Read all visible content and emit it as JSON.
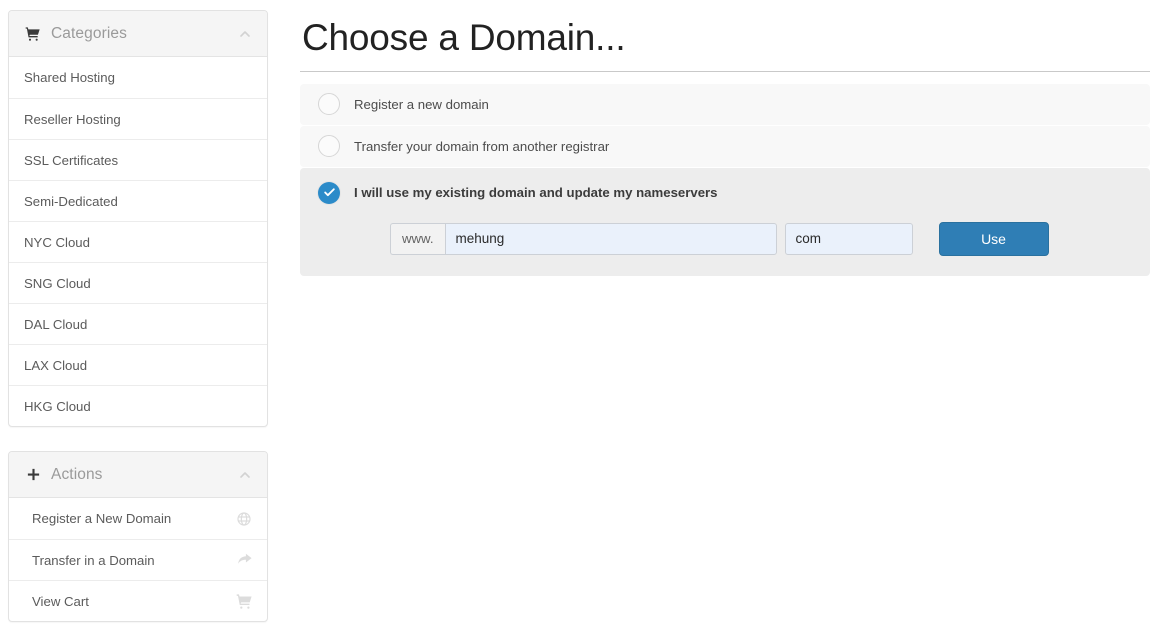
{
  "sidebar": {
    "categories_panel": {
      "icon": "cart-icon",
      "title": "Categories",
      "collapse_icon": "chevron-up-icon",
      "items": [
        {
          "label": "Shared Hosting"
        },
        {
          "label": "Reseller Hosting"
        },
        {
          "label": "SSL Certificates"
        },
        {
          "label": "Semi-Dedicated"
        },
        {
          "label": "NYC Cloud"
        },
        {
          "label": "SNG Cloud"
        },
        {
          "label": "DAL Cloud"
        },
        {
          "label": "LAX Cloud"
        },
        {
          "label": "HKG Cloud"
        }
      ]
    },
    "actions_panel": {
      "icon": "plus-icon",
      "title": "Actions",
      "collapse_icon": "chevron-up-icon",
      "items": [
        {
          "label": "Register a New Domain",
          "icon": "globe-icon"
        },
        {
          "label": "Transfer in a Domain",
          "icon": "share-arrow-icon"
        },
        {
          "label": "View Cart",
          "icon": "cart-icon"
        }
      ]
    }
  },
  "main": {
    "title": "Choose a Domain...",
    "options": [
      {
        "label": "Register a new domain",
        "selected": false
      },
      {
        "label": "Transfer your domain from another registrar",
        "selected": false
      },
      {
        "label": "I will use my existing domain and update my nameservers",
        "selected": true
      }
    ],
    "domain_form": {
      "prefix_addon": "www.",
      "domain_value": "mehung",
      "domain_placeholder": "",
      "tld_value": "com",
      "tld_placeholder": "",
      "submit_label": "Use"
    }
  },
  "colors": {
    "accent_blue": "#2c8bc9",
    "button_blue": "#2f7eb5",
    "panel_selected_bg": "#ededed",
    "panel_row_bg": "#f8f8f8",
    "input_bg": "#eaf1fb"
  }
}
